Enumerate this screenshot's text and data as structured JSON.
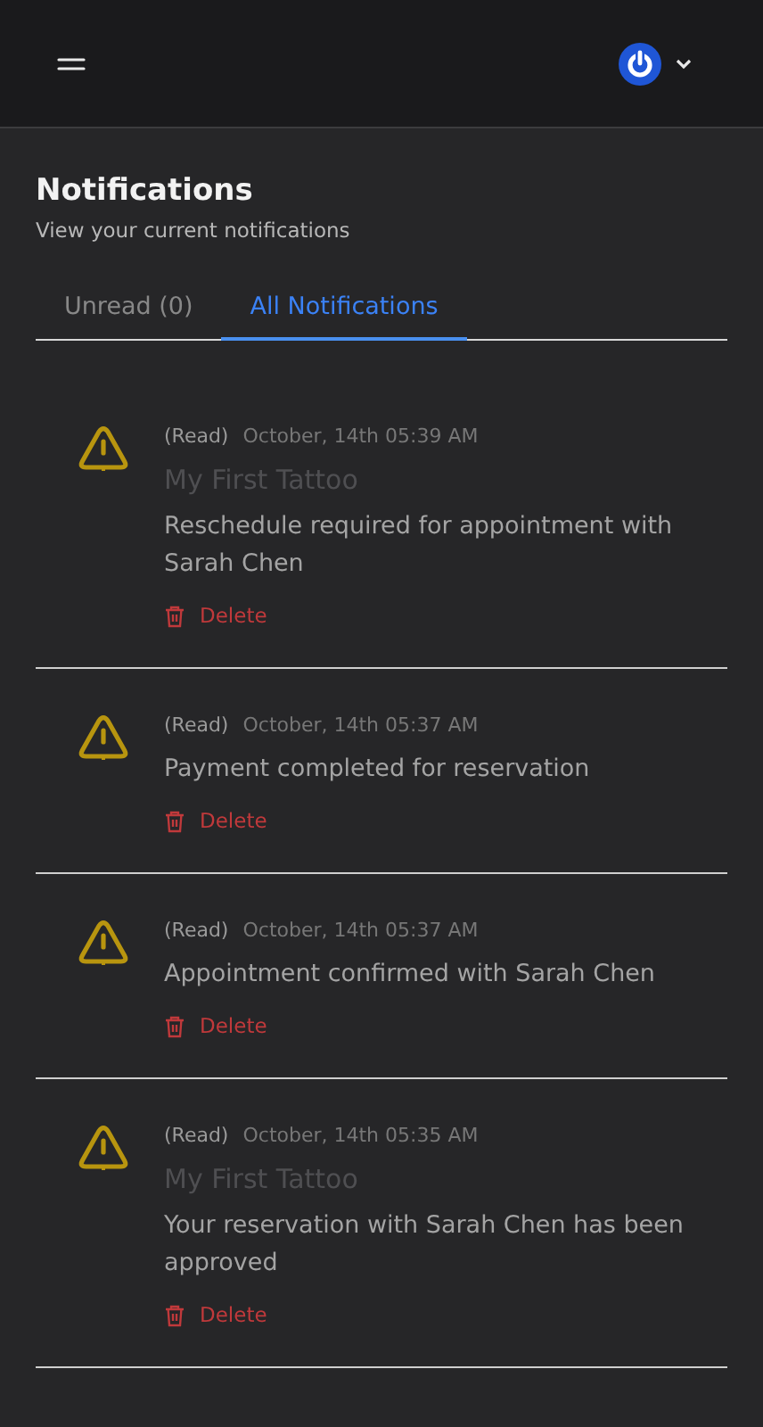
{
  "page": {
    "title": "Notifications",
    "subtitle": "View your current notifications"
  },
  "tabs": [
    {
      "label": "Unread (0)",
      "selected": false
    },
    {
      "label": "All Notifications",
      "selected": true
    }
  ],
  "notifications": [
    {
      "status": "(Read)",
      "time": "October, 14th 05:39 AM",
      "title": "My First Tattoo",
      "message": "Reschedule required for appointment with Sarah Chen",
      "action": "Delete"
    },
    {
      "status": "(Read)",
      "time": "October, 14th 05:37 AM",
      "message": "Payment completed for reservation",
      "action": "Delete"
    },
    {
      "status": "(Read)",
      "time": "October, 14th 05:37 AM",
      "message": "Appointment confirmed with Sarah Chen",
      "action": "Delete"
    },
    {
      "status": "(Read)",
      "time": "October, 14th 05:35 AM",
      "title": "My First Tattoo",
      "message": "Your reservation with Sarah Chen has been approved",
      "action": "Delete"
    }
  ]
}
